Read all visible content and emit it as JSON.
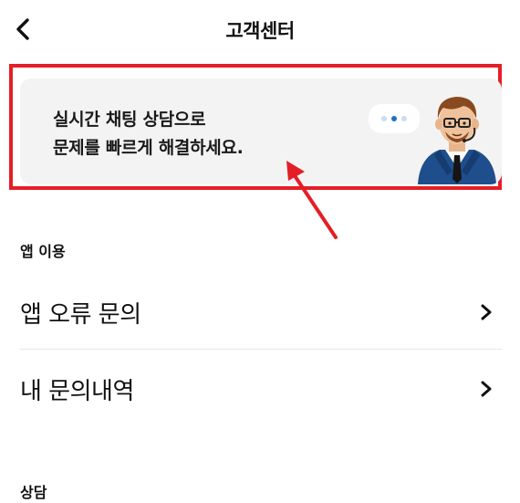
{
  "header": {
    "title": "고객센터",
    "back_icon": "chevron-left-icon"
  },
  "banner": {
    "line1": "실시간 채팅 상담으로",
    "line2": "문제를 빠르게 해결하세요.",
    "illustration": "agent-avatar",
    "bubble_icon": "typing-dots-icon",
    "highlight_color": "#e41e26",
    "background_color": "#f3f3f3"
  },
  "annotation": {
    "arrow_icon": "red-arrow-icon",
    "color": "#e41e26"
  },
  "sections": {
    "app_usage": {
      "label": "앱 이용",
      "items": [
        {
          "label": "앱 오류 문의",
          "icon": "chevron-right-icon"
        },
        {
          "label": "내 문의내역",
          "icon": "chevron-right-icon"
        }
      ]
    },
    "consultation": {
      "label": "상담"
    }
  },
  "colors": {
    "accent_blue": "#1f6fd1",
    "light_blue": "#a9c8ee",
    "text": "#111111",
    "divider": "#e8e8e8"
  }
}
